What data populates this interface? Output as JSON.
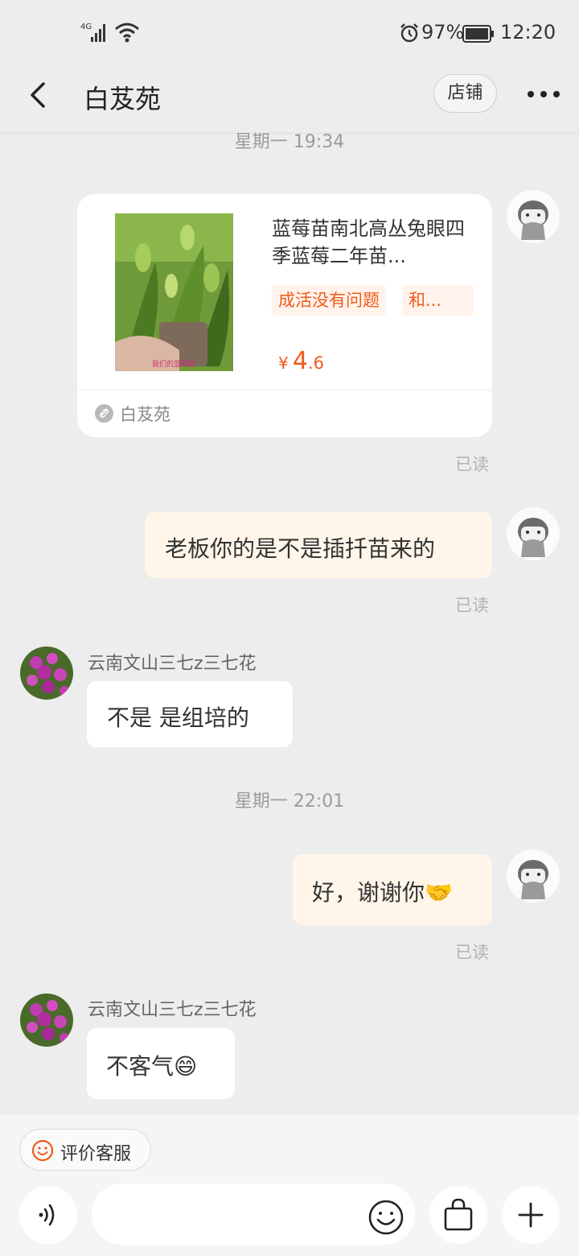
{
  "status_bar": {
    "network": "4G",
    "battery_percent": "97%",
    "time": "12:20",
    "icons": [
      "signal-icon",
      "wifi-icon",
      "alarm-icon",
      "battery-icon"
    ]
  },
  "header": {
    "title": "白芨苑",
    "shop_button": "店铺",
    "icons": [
      "back-icon",
      "more-icon"
    ]
  },
  "chat": {
    "timestamp_1": "星期一 19:34",
    "product_card": {
      "title": "蓝莓苗南北高丛兔眼四季蓝莓二年苗...",
      "image_caption": "我们的蓝莓苗",
      "tags": [
        "成活没有问题",
        "和..."
      ],
      "price_symbol": "¥",
      "price_int": "4",
      "price_dec": ".6",
      "shop_name": "白芨苑"
    },
    "read_1": "已读",
    "message_me_1": "老板你的是不是插扦苗来的",
    "read_2": "已读",
    "sender_1": "云南文山三七z三七花",
    "message_them_1": "不是  是组培的",
    "timestamp_2": "星期一 22:01",
    "message_me_2": "好，谢谢你🤝",
    "read_3": "已读",
    "sender_2": "云南文山三七z三七花",
    "message_them_2": "不客气😄"
  },
  "bottom": {
    "rate_label": "评价客服",
    "input_placeholder": "",
    "icons": [
      "voice-icon",
      "emoji-icon",
      "shopping-bag-icon",
      "plus-icon"
    ]
  },
  "colors": {
    "accent": "#f05a1a",
    "my_bubble": "#fff6e9",
    "their_bubble": "#ffffff",
    "background": "#ededed"
  }
}
